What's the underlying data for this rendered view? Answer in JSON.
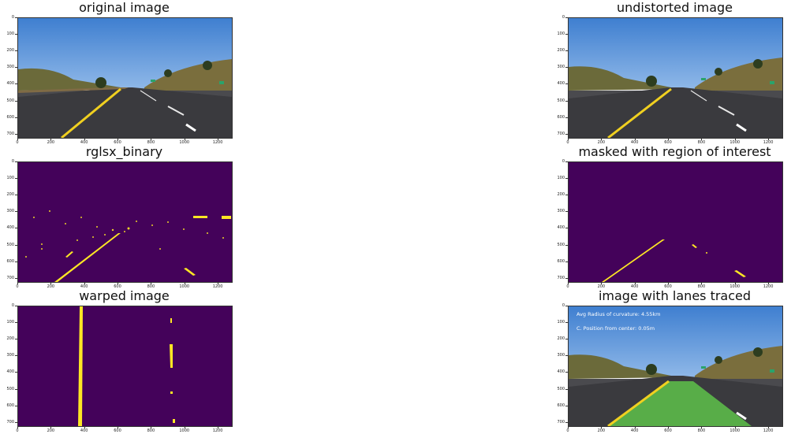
{
  "figure": {
    "panels": [
      {
        "id": "original",
        "title": "original image"
      },
      {
        "id": "undistorted",
        "title": "undistorted image"
      },
      {
        "id": "binary",
        "title": "rglsx_binary"
      },
      {
        "id": "masked",
        "title": "masked with region of interest"
      },
      {
        "id": "warped",
        "title": "warped image"
      },
      {
        "id": "traced",
        "title": "image with lanes traced"
      }
    ],
    "y_ticks": [
      "0",
      "100",
      "200",
      "300",
      "400",
      "500",
      "600",
      "700"
    ],
    "x_ticks": [
      "0",
      "200",
      "400",
      "600",
      "800",
      "1000",
      "1200"
    ],
    "overlay": {
      "radius": "Avg Radius of curvature: 4.55km",
      "position": "C. Position from center: 0.05m"
    },
    "colors": {
      "sky": "#4f8fd8",
      "road": "#3a3a3e",
      "binary_bg": "#44025a",
      "binary_fg": "#fde724",
      "lane_fill": "#5ec24a",
      "lane_yellow": "#f0d020"
    }
  }
}
